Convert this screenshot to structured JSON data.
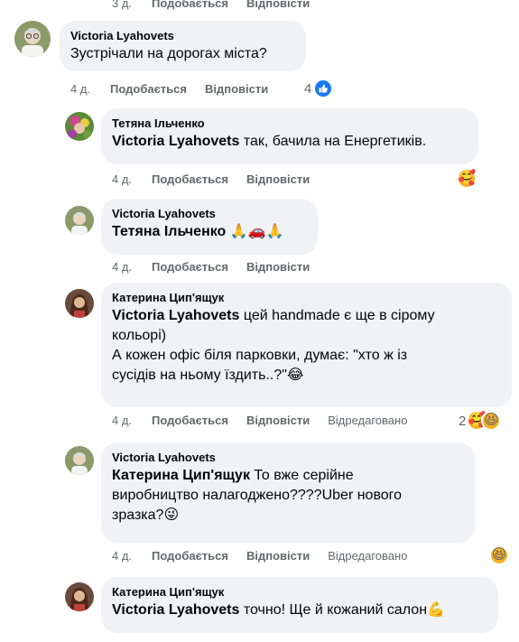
{
  "top": {
    "time": "3 д.",
    "like": "Подобається",
    "reply": "Відповісти"
  },
  "comments": [
    {
      "author": "Victoria Lyahovets",
      "text": "Зустрічали на дорогах міста?",
      "time": "4 д.",
      "like": "Подобається",
      "reply": "Відповісти",
      "reaction_count": "4"
    },
    {
      "author": "Тетяна Ільченко",
      "mention": "Victoria Lyahovets",
      "text": " так, бачила на Енергетиків.",
      "time": "4 д.",
      "like": "Подобається",
      "reply": "Відповісти"
    },
    {
      "author": "Victoria Lyahovets",
      "mention": "Тетяна Ільченко",
      "text": " 🙏🚗🙏",
      "time": "4 д.",
      "like": "Подобається",
      "reply": "Відповісти"
    },
    {
      "author": "Катерина Цип'ящук",
      "mention": "Victoria Lyahovets",
      "text_line1": " цей handmade є ще в сірому",
      "text_line2": "кольорі)",
      "text_line3": "А кожен офіс біля парковки, думає: \"хто ж із",
      "text_line4": "сусідів на ньому їздить..?\"😂",
      "time": "4 д.",
      "like": "Подобається",
      "reply": "Відповісти",
      "edited": "Відредаговано",
      "reaction_count": "2"
    },
    {
      "author": "Victoria Lyahovets",
      "mention": "Катерина Цип'ящук",
      "text_line1": " То вже серійне",
      "text_line2": "виробництво налагоджено????Uber нового",
      "text_line3": "зразка?😜",
      "time": "4 д.",
      "like": "Подобається",
      "reply": "Відповісти",
      "edited": "Відредаговано"
    },
    {
      "author": "Катерина Цип'ящук",
      "mention": "Victoria Lyahovets",
      "text": " точно! Ще й кожаний салон💪"
    }
  ]
}
